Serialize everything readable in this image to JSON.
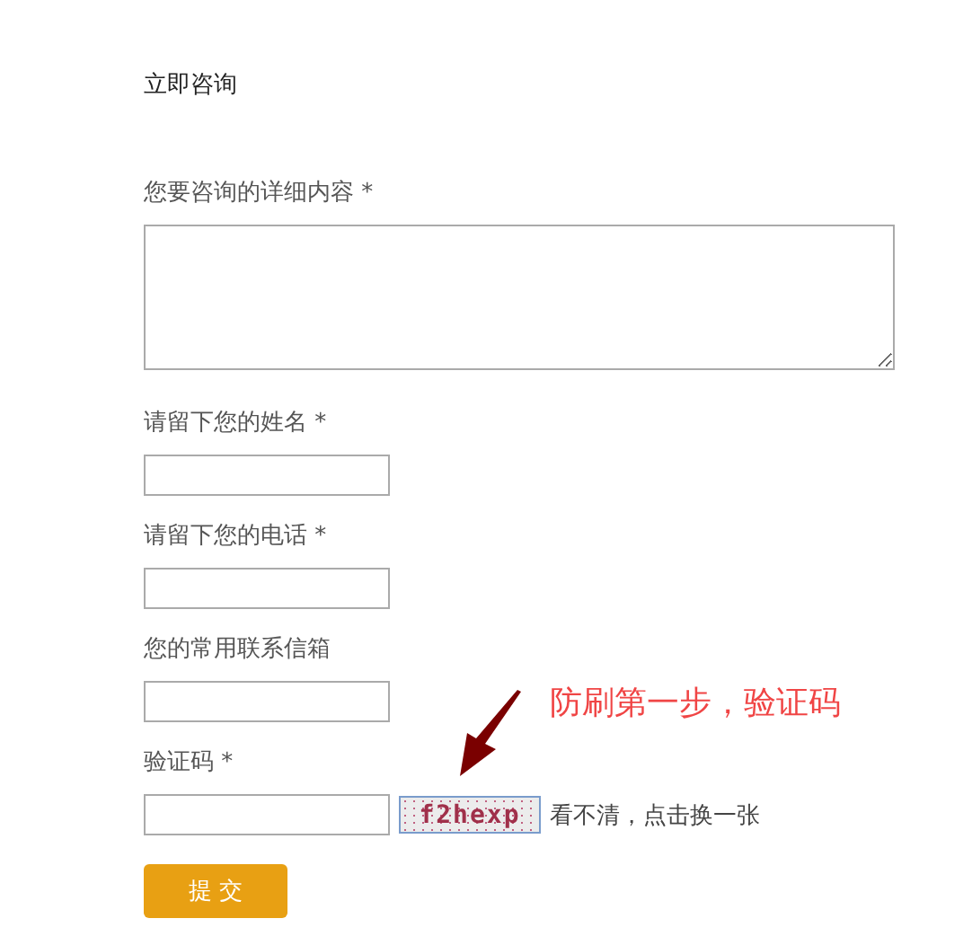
{
  "title": "立即咨询",
  "fields": [
    {
      "kind": "textarea",
      "label": "您要咨询的详细内容 *"
    },
    {
      "kind": "input",
      "label": "请留下您的姓名 *"
    },
    {
      "kind": "input",
      "label": "请留下您的电话 *"
    },
    {
      "kind": "input",
      "label": "您的常用联系信箱"
    },
    {
      "kind": "captcha",
      "label": "验证码 *",
      "captcha_text": "f2hexp",
      "refresh_link": "看不清，点击换一张"
    }
  ],
  "submit_button": "提 交",
  "annotation": {
    "text": "防刷第一步，验证码"
  }
}
